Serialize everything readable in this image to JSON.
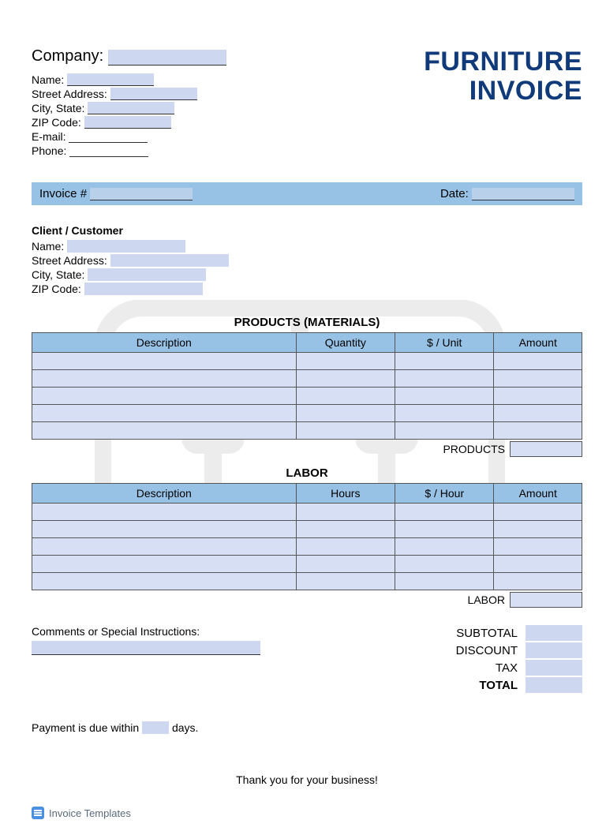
{
  "title": {
    "line1": "FURNITURE",
    "line2": "INVOICE"
  },
  "company": {
    "label": "Company:",
    "name_label": "Name:",
    "street_label": "Street Address:",
    "city_state_label": "City, State:",
    "zip_label": "ZIP Code:",
    "email_label": "E-mail:",
    "phone_label": "Phone:"
  },
  "invoice_bar": {
    "invoice_label": "Invoice #",
    "date_label": "Date:"
  },
  "client": {
    "heading": "Client / Customer",
    "name_label": "Name:",
    "street_label": "Street Address:",
    "city_state_label": "City, State:",
    "zip_label": "ZIP Code:"
  },
  "products": {
    "title": "PRODUCTS (MATERIALS)",
    "headers": {
      "desc": "Description",
      "qty": "Quantity",
      "unit": "$ / Unit",
      "amount": "Amount"
    },
    "subtotal_label": "PRODUCTS"
  },
  "labor": {
    "title": "LABOR",
    "headers": {
      "desc": "Description",
      "hours": "Hours",
      "rate": "$ / Hour",
      "amount": "Amount"
    },
    "subtotal_label": "LABOR"
  },
  "comments": {
    "label": "Comments or Special Instructions:"
  },
  "totals": {
    "subtotal": "SUBTOTAL",
    "discount": "DISCOUNT",
    "tax": "TAX",
    "total": "TOTAL"
  },
  "payment": {
    "prefix": "Payment is due within",
    "suffix": "days."
  },
  "thanks": "Thank you for your business!",
  "footer_brand": "Invoice Templates"
}
